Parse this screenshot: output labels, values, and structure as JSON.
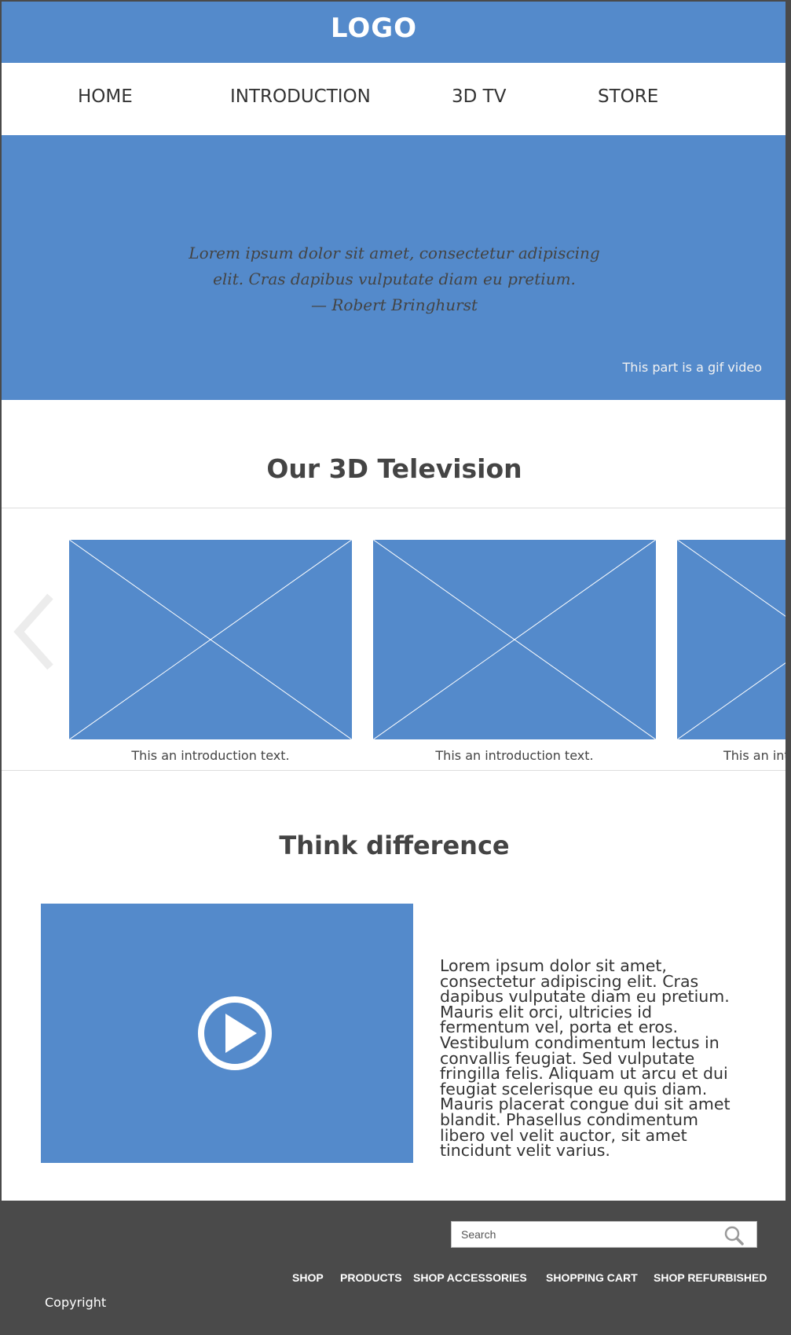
{
  "header": {
    "logo": "LOGO"
  },
  "nav": {
    "items": [
      {
        "label": "HOME"
      },
      {
        "label": "INTRODUCTION"
      },
      {
        "label": "3D TV"
      },
      {
        "label": "STORE"
      }
    ]
  },
  "hero": {
    "quote_lines": [
      "Lorem ipsum dolor sit amet, consectetur adipiscing",
      "elit.  Cras dapibus vulputate diam eu pretium.",
      "— Robert Bringhurst"
    ],
    "note": "This part is a gif video"
  },
  "products": {
    "title": "Our 3D Television",
    "slides": [
      {
        "caption": "This an introduction text."
      },
      {
        "caption": "This an introduction text."
      },
      {
        "caption": "This an int"
      }
    ]
  },
  "feature": {
    "title": "Think difference",
    "body_lines": [
      "Lorem ipsum dolor sit amet,",
      "consectetur adipiscing elit. Cras",
      "dapibus vulputate diam eu pretium.",
      "Mauris elit orci, ultricies id",
      "fermentum vel, porta et eros.",
      "Vestibulum condimentum lectus in",
      "convallis feugiat. Sed vulputate",
      "fringilla felis. Aliquam ut arcu et dui",
      "feugiat scelerisque eu quis diam.",
      "Mauris placerat congue dui sit amet",
      "blandit. Phasellus condimentum",
      "libero vel velit auctor, sit amet",
      "tincidunt velit varius."
    ]
  },
  "footer": {
    "search_placeholder": "Search",
    "links": [
      {
        "label": "SHOP"
      },
      {
        "label": "PRODUCTS"
      },
      {
        "label": "SHOP ACCESSORIES"
      },
      {
        "label": "SHOPPING CART"
      },
      {
        "label": "SHOP REFURBISHED"
      }
    ],
    "copyright": "Copyright"
  },
  "colors": {
    "accent": "#548acb",
    "footer_bg": "#4a4a4a",
    "text_dark": "#444444"
  },
  "icons": {
    "carousel_prev": "chevron-left-icon",
    "play": "play-icon",
    "search": "search-icon",
    "placeholder_image": "image-placeholder-icon"
  }
}
